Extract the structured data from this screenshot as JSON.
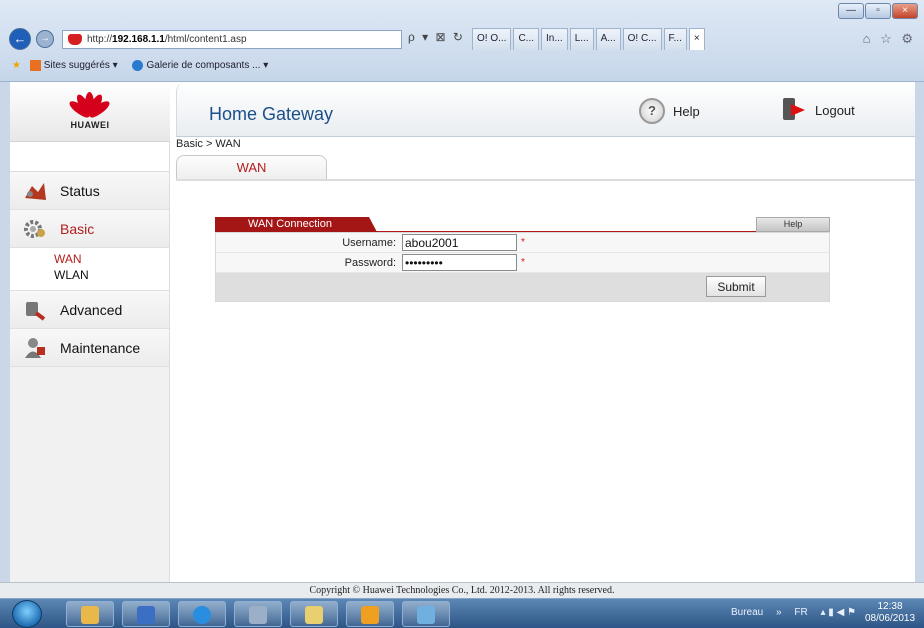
{
  "browser": {
    "url_prefix": "http://",
    "url_host": "192.168.1.1",
    "url_path": "/html/content1.asp",
    "address_tools": "ρ ▾ ⊠ ↻",
    "tabs": [
      "O! O...",
      "C...",
      "In...",
      "L...",
      "A...",
      "O! C...",
      "F...",
      "×"
    ],
    "favorites": [
      "Sites suggérés ▾",
      "Galerie de composants ... ▾"
    ],
    "window_buttons": [
      "—",
      "▫",
      "×"
    ]
  },
  "brand": {
    "name": "HUAWEI"
  },
  "sidebar": {
    "items": [
      {
        "label": "Status",
        "icon": "status-icon"
      },
      {
        "label": "Basic",
        "icon": "basic-icon",
        "active": true
      },
      {
        "label": "Advanced",
        "icon": "advanced-icon"
      },
      {
        "label": "Maintenance",
        "icon": "maintenance-icon"
      }
    ],
    "sub_items": [
      {
        "label": "WAN",
        "active": true
      },
      {
        "label": "WLAN"
      }
    ]
  },
  "header": {
    "title": "Home Gateway",
    "help_label": "Help",
    "logout_label": "Logout"
  },
  "breadcrumb": "Basic > WAN",
  "subtab": "WAN",
  "panel": {
    "title": "WAN Connection",
    "help_label": "Help",
    "username_label": "Username:",
    "username_value": "abou2001",
    "password_label": "Password:",
    "password_value": "abou20011",
    "required_mark": "*",
    "submit_label": "Submit"
  },
  "footer": "Copyright © Huawei Technologies Co., Ltd. 2012-2013. All rights reserved.",
  "taskbar": {
    "tray_location": "Bureau",
    "tray_arrows": "»",
    "language": "FR",
    "time": "12:38",
    "date": "08/06/2013"
  },
  "colors": {
    "accent": "#b41d1d",
    "title_blue": "#1b4f8a",
    "panel_red": "#a41515"
  }
}
